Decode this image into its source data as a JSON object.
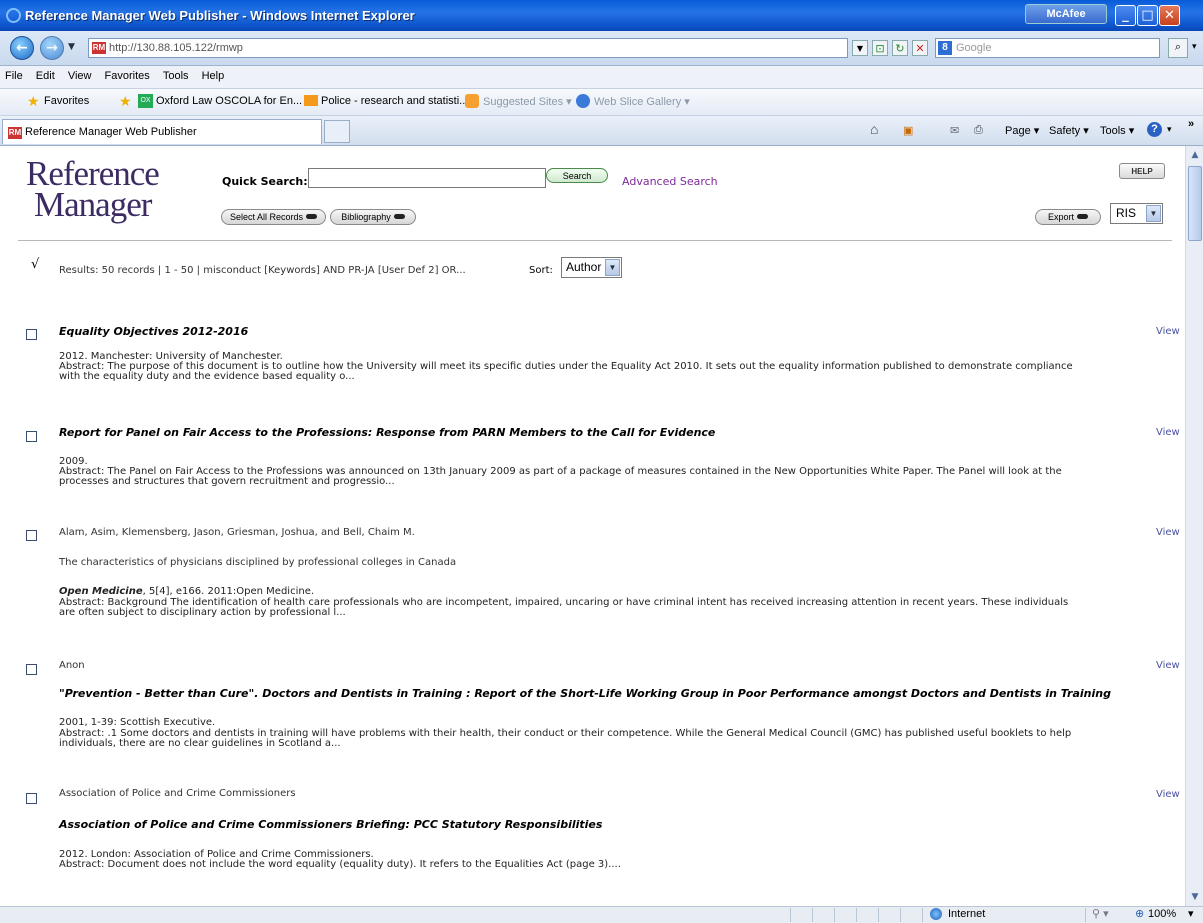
{
  "window": {
    "title": "Reference Manager Web Publisher - Windows Internet Explorer",
    "mcafee": "McAfee"
  },
  "address": {
    "url": "http://130.88.105.122/rmwp",
    "search_placeholder": "Google"
  },
  "menu": [
    "File",
    "Edit",
    "View",
    "Favorites",
    "Tools",
    "Help"
  ],
  "favorites": {
    "label": "Favorites",
    "items": [
      "Oxford Law  OSCOLA for En...",
      "Police - research and statisti...",
      "Suggested Sites ▾",
      "Web Slice Gallery ▾"
    ]
  },
  "tab": {
    "title": "Reference Manager Web Publisher"
  },
  "commands": {
    "page": "Page ▾",
    "safety": "Safety ▾",
    "tools": "Tools ▾"
  },
  "app": {
    "logo_line1": "Reference",
    "logo_line2": "Manager",
    "quick_search_label": "Quick Search:",
    "search_button": "Search",
    "advanced_search": "Advanced Search",
    "help_button": "HELP",
    "select_all_button": "Select All Records",
    "bibliography_button": "Bibliography",
    "export_button": "Export",
    "export_format": "RIS",
    "check_mark": "√",
    "results_summary": "Results:  50 records | 1 - 50 | misconduct [Keywords] AND PR-JA [User Def 2] OR...",
    "sort_label": "Sort:",
    "sort_value": "Author"
  },
  "records": [
    {
      "title": "Equality Objectives 2012-2016",
      "pub": "2012. Manchester: University of Manchester.",
      "abstract1": "Abstract: The purpose of this document is to outline how the University will meet its specific duties under the Equality Act 2010. It sets out the equality information published to demonstrate compliance",
      "abstract2": "with the equality duty and the evidence based equality o...",
      "view": "View"
    },
    {
      "title": "Report for Panel on Fair Access to the Professions: Response from PARN Members to the Call for Evidence",
      "pub": "2009.",
      "abstract1": "Abstract: The Panel on Fair Access to the Professions was announced on 13th January 2009 as part of a package of measures contained in the New Opportunities White Paper. The Panel will look at the",
      "abstract2": "processes and structures that govern recruitment and progressio...",
      "view": "View"
    },
    {
      "authors": "Alam, Asim, Klemensberg, Jason, Griesman, Joshua, and Bell, Chaim M.",
      "article": "The characteristics of physicians disciplined by professional colleges in Canada",
      "journal": "Open Medicine",
      "pub": ", 5[4], e166. 2011:Open Medicine.",
      "abstract1": "Abstract: Background The identification of health care professionals who are incompetent, impaired, uncaring or have criminal intent has received increasing attention in recent years. These individuals",
      "abstract2": "are often subject to disciplinary action by professional l...",
      "view": "View"
    },
    {
      "authors": "Anon",
      "title": "\"Prevention - Better than Cure\". Doctors and Dentists in Training : Report of the Short-Life Working Group in Poor Performance amongst Doctors and Dentists in Training",
      "pub": "2001, 1-39: Scottish Executive.",
      "abstract1": "Abstract: .1 Some doctors and dentists in training will have problems with their health, their conduct or their competence. While the General Medical Council (GMC) has published useful booklets to help",
      "abstract2": "individuals, there are no clear guidelines in Scotland a...",
      "view": "View"
    },
    {
      "authors": "Association of Police and Crime Commissioners",
      "title": "Association of Police and Crime Commissioners Briefing: PCC Statutory Responsibilities",
      "pub": "2012. London: Association of Police and Crime Commissioners.",
      "abstract1": "Abstract: Document does not include the word equality (equality duty). It refers to the Equalities Act (page 3)....",
      "view": "View"
    }
  ],
  "status": {
    "zone": "Internet",
    "zoom": "100%"
  }
}
